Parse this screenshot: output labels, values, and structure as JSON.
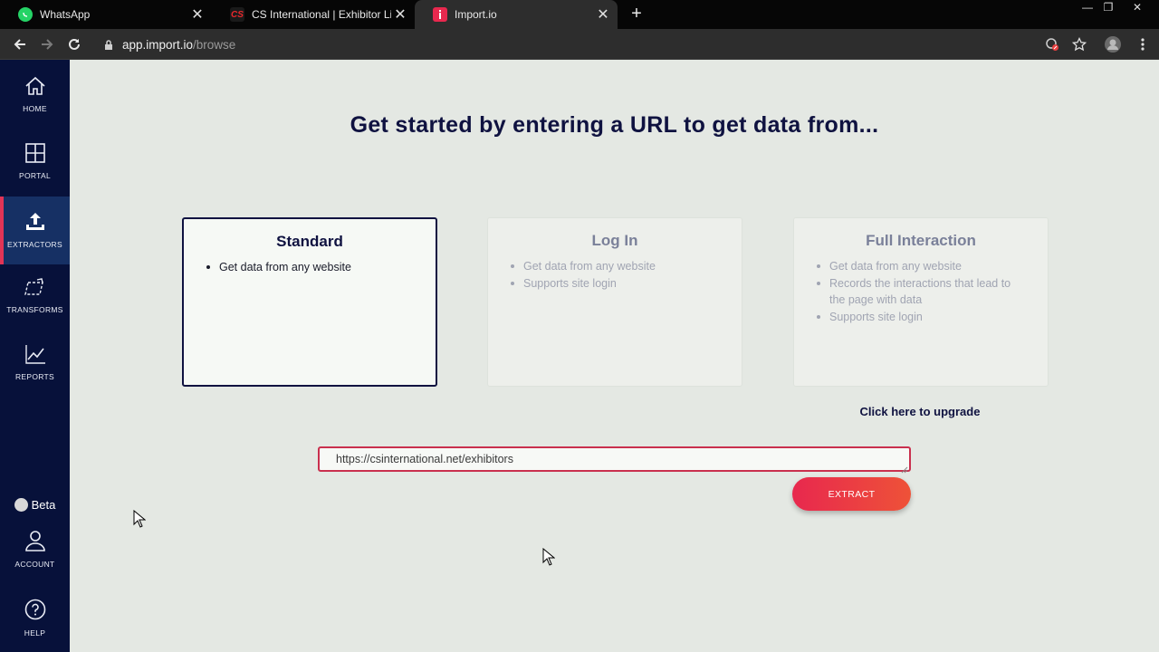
{
  "browser": {
    "tabs": [
      {
        "title": "WhatsApp",
        "favicon": "whatsapp-icon"
      },
      {
        "title": "CS International | Exhibitor List",
        "favicon": "cs-icon",
        "favicon_text": "CS"
      },
      {
        "title": "Import.io",
        "favicon": "importio-icon",
        "active": true
      }
    ],
    "address": {
      "host": "app.import.io",
      "path": "/browse"
    }
  },
  "sidebar": {
    "items": [
      {
        "label": "HOME",
        "icon": "home-icon"
      },
      {
        "label": "PORTAL",
        "icon": "grid-icon"
      },
      {
        "label": "EXTRACTORS",
        "icon": "upload-icon",
        "active": true
      },
      {
        "label": "TRANSFORMS",
        "icon": "transform-icon"
      },
      {
        "label": "REPORTS",
        "icon": "chart-icon"
      }
    ],
    "beta_label": "Beta",
    "account_label": "ACCOUNT",
    "help_label": "HELP"
  },
  "main": {
    "headline": "Get started by entering a URL to get data from...",
    "cards": [
      {
        "title": "Standard",
        "bullets": [
          "Get data from any website"
        ],
        "selected": true
      },
      {
        "title": "Log In",
        "bullets": [
          "Get data from any website",
          "Supports site login"
        ],
        "selected": false
      },
      {
        "title": "Full Interaction",
        "bullets": [
          "Get data from any website",
          "Records the interactions that lead to the page with data",
          "Supports site login"
        ],
        "selected": false
      }
    ],
    "upgrade_link": "Click here to upgrade",
    "url_input": {
      "value": "https://csinternational.net/exhibitors"
    },
    "extract_button": "EXTRACT"
  },
  "colors": {
    "sidebar": "#07113a",
    "accent": "#e8284e",
    "headline": "#0f1240",
    "background": "#e4e8e3"
  }
}
